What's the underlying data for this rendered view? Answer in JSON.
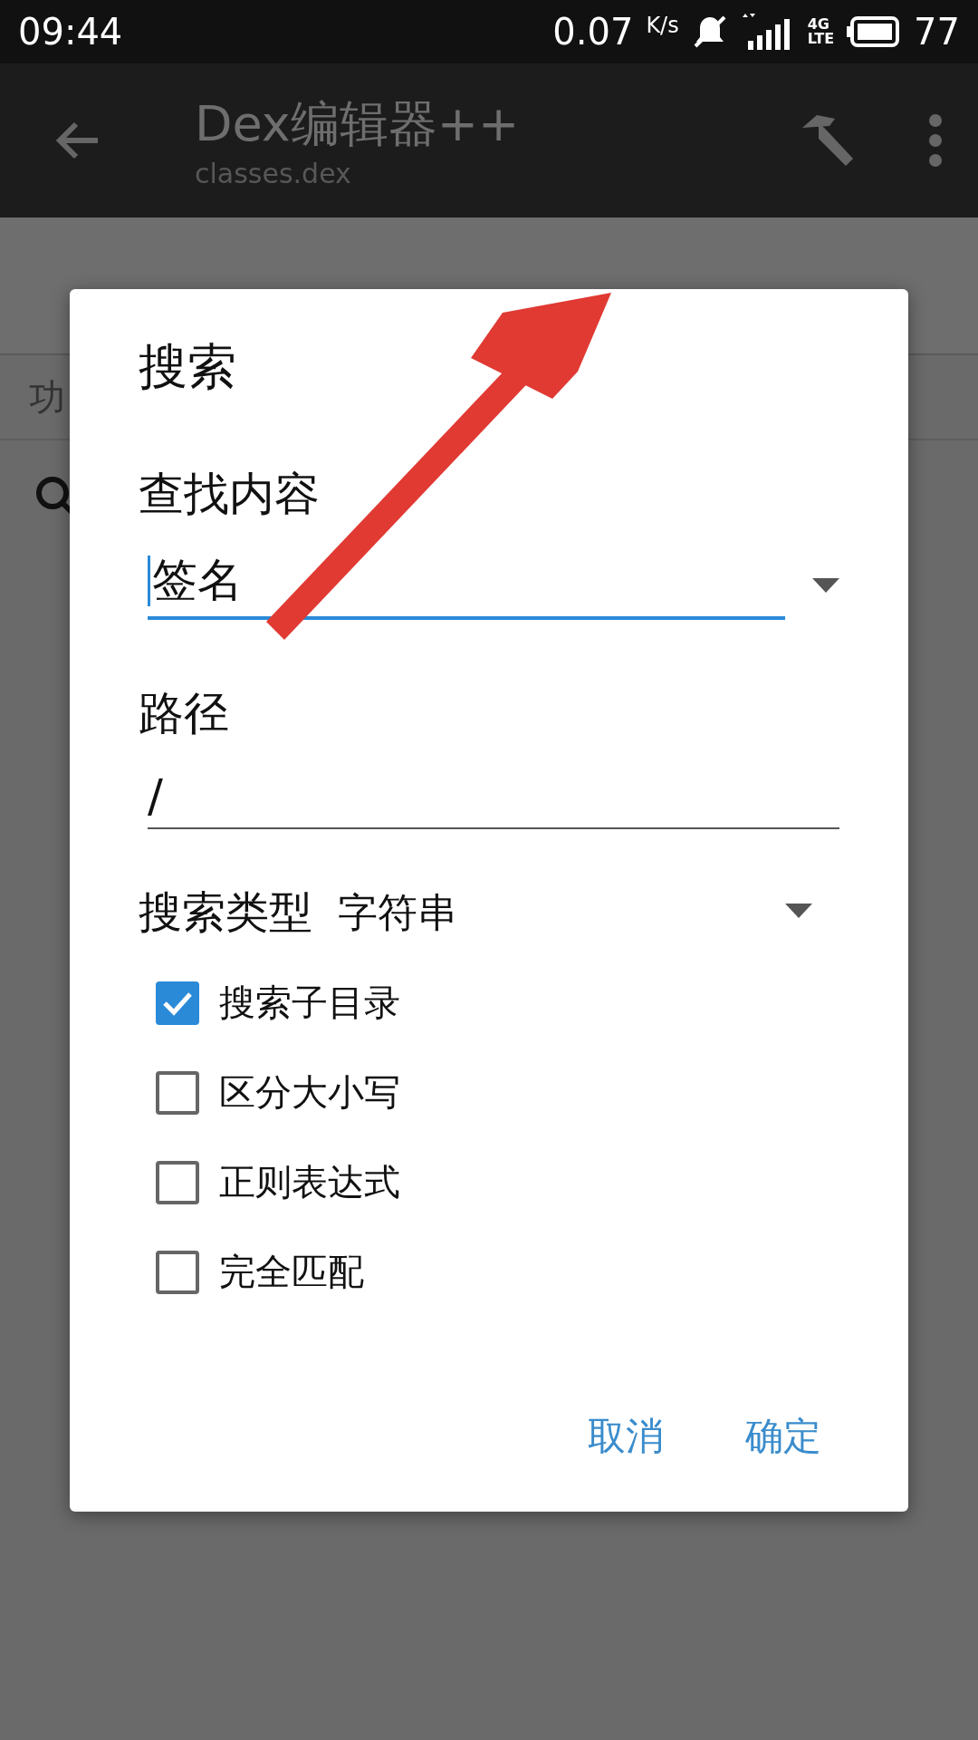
{
  "status_bar": {
    "time": "09:44",
    "speed": "0.07",
    "speed_unit": "K/s",
    "network": "4G",
    "network_sub": "LTE",
    "battery": "77"
  },
  "app_bar": {
    "title": "Dex编辑器++",
    "subtitle": "classes.dex"
  },
  "sub_header": {
    "label": "功"
  },
  "dialog": {
    "title": "搜索",
    "fields": [
      {
        "label": "查找内容",
        "value": "签名",
        "focused": true,
        "dropdown": true
      },
      {
        "label": "路径",
        "value": "/",
        "focused": false,
        "dropdown": false
      }
    ],
    "search_type_label": "搜索类型",
    "search_type_value": "字符串",
    "options": [
      {
        "label": "搜索子目录",
        "checked": true
      },
      {
        "label": "区分大小写",
        "checked": false
      },
      {
        "label": "正则表达式",
        "checked": false
      },
      {
        "label": "完全匹配",
        "checked": false
      }
    ],
    "buttons": [
      "取消",
      "确定"
    ]
  }
}
